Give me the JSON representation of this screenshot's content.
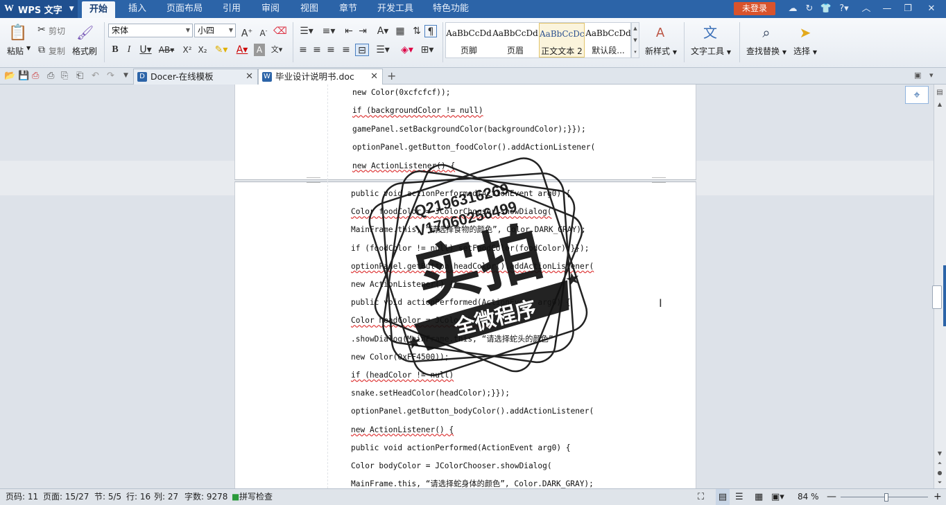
{
  "app": {
    "name": "WPS 文字",
    "logo": "W"
  },
  "menu": [
    "开始",
    "插入",
    "页面布局",
    "引用",
    "审阅",
    "视图",
    "章节",
    "开发工具",
    "特色功能"
  ],
  "login_label": "未登录",
  "ribbon": {
    "paste": "粘贴",
    "cut": "剪切",
    "copy": "复制",
    "format_painter": "格式刷",
    "font_name": "宋体",
    "font_size": "小四",
    "styles": [
      {
        "preview": "AaBbCcDd",
        "name": "页脚"
      },
      {
        "preview": "AaBbCcDd",
        "name": "页眉"
      },
      {
        "preview": "AaBbCcDc",
        "name": "正文文本 2"
      },
      {
        "preview": "AaBbCcDd",
        "name": "默认段..."
      }
    ],
    "new_style": "新样式",
    "text_tools": "文字工具",
    "find_replace": "查找替换",
    "select": "选择"
  },
  "tabs": [
    {
      "label": "Docer-在线模板",
      "icon": "D"
    },
    {
      "label": "毕业设计说明书.doc",
      "icon": "W"
    }
  ],
  "document": {
    "page1_lines": [
      "new Color(0xcfcfcf));",
      "if (backgroundColor != null)",
      "gamePanel.setBackgroundColor(backgroundColor);}});",
      "optionPanel.getButton_foodColor().addActionListener(",
      "new ActionListener() {"
    ],
    "page2_lines": [
      "public void actionPerformed(ActionEvent arg0) {",
      "Color foodColor = JColorChooser.showDialog(",
      "MainFrame.this, “请选择食物的颜色”, Color.DARK_GRAY);",
      "if (foodColor != null) setFoodColor(foodColor);}});",
      "optionPanel.getButton_headColor().addActionListener(",
      "new ActionListener() {",
      "public void actionPerformed(ActionEvent arg0) {",
      "Color headColor = JColorChooser",
      ".showDialog(MainFrame.this, “请选择蛇头的颜色”,",
      "new Color(0xFF4500));",
      "if (headColor != null)",
      "snake.setHeadColor(headColor);}});",
      "optionPanel.getButton_bodyColor().addActionListener(",
      "new ActionListener() {",
      "public void actionPerformed(ActionEvent arg0) {",
      "Color bodyColor = JColorChooser.showDialog(",
      "MainFrame.this, “请选择蛇身体的颜色”, Color.DARK_GRAY);"
    ]
  },
  "watermark": {
    "line1": "Q2196316269",
    "line2": "V17060256499",
    "main": "实拍",
    "banner": "全微程序"
  },
  "status": {
    "page_code": "页码: 11",
    "page": "页面: 15/27",
    "section": "节: 5/5",
    "row": "行: 16",
    "col": "列: 27",
    "word_count": "字数: 9278",
    "spell_check": "拼写检查",
    "zoom": "84 %"
  },
  "colors": {
    "titlebar": "#2c64a8",
    "login": "#d9532c",
    "accent": "#2c64a8"
  }
}
